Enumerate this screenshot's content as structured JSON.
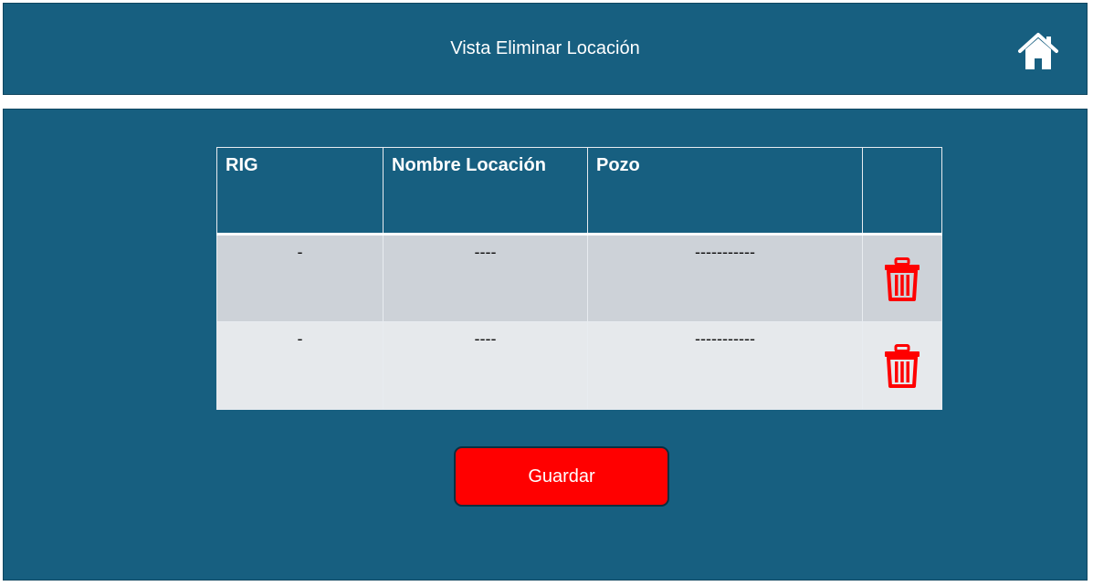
{
  "header": {
    "title": "Vista Eliminar Locación",
    "home_icon": "home-icon"
  },
  "table": {
    "columns": [
      "RIG",
      "Nombre Locación",
      "Pozo",
      ""
    ],
    "rows": [
      {
        "rig": "-",
        "nombre_locacion": "----",
        "pozo": "-----------",
        "action_icon": "trash-icon"
      },
      {
        "rig": "-",
        "nombre_locacion": "----",
        "pozo": "-----------",
        "action_icon": "trash-icon"
      }
    ]
  },
  "actions": {
    "save_label": "Guardar"
  },
  "colors": {
    "panel": "#175f80",
    "delete": "#ff0000",
    "row_a": "#cdd2d8",
    "row_b": "#e6e9ec"
  }
}
